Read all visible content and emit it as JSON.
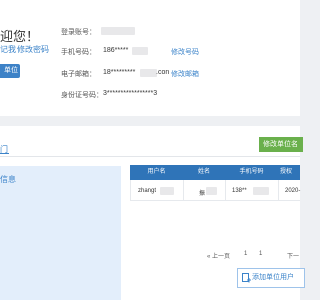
{
  "profile": {
    "welcome": "迎您！",
    "link_a": "记我",
    "link_b": "修改密码",
    "unit_button": "单位"
  },
  "account": {
    "login_label": "登录账号：",
    "phone_label": "手机号码：",
    "phone_value": "186*****",
    "phone_change": "修改号码",
    "email_label": "电子邮箱：",
    "email_value": "18*********",
    "email_suffix": ".con",
    "email_change": "修改邮箱",
    "id_label": "身份证号码：",
    "id_value": "3*****************3"
  },
  "unit": {
    "section_title": "门",
    "modify_button": "修改单位名",
    "side_title": "信息",
    "table": {
      "headers": [
        "用户名",
        "姓名",
        "手机号码",
        "授权"
      ],
      "rows": [
        [
          "zhangt",
          "振",
          "138**",
          "2020-"
        ]
      ]
    },
    "pagination": {
      "prev": "« 上一页",
      "page_current": "1",
      "page_total": "1",
      "next": "下一"
    },
    "add_user_button": "添加单位用户"
  },
  "colors": {
    "accent": "#3b83c9",
    "table_header": "#2f74b8",
    "green_button": "#6ab04c",
    "side_panel": "#e3eefb"
  }
}
